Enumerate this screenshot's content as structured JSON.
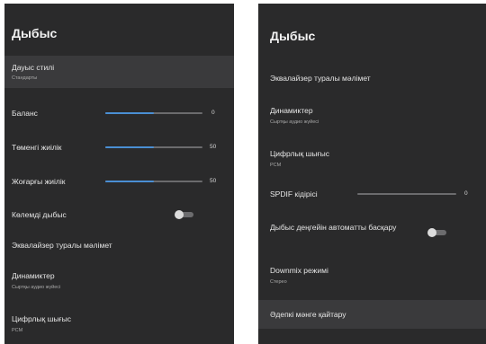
{
  "left": {
    "title": "Дыбыс",
    "items": [
      {
        "label": "Дауыс стилі",
        "sub": "Стандарты"
      },
      {
        "label": "Баланс",
        "value": "0",
        "level": 0.5
      },
      {
        "label": "Төменгі жиілік",
        "value": "50",
        "level": 0.5
      },
      {
        "label": "Жоғарғы жиілік",
        "value": "50",
        "level": 0.5
      },
      {
        "label": "Көлемді дыбыс",
        "toggle": false
      },
      {
        "label": "Эквалайзер туралы мәлімет"
      },
      {
        "label": "Динамиктер",
        "sub": "Сыртқы аудио жүйесі"
      },
      {
        "label": "Цифрлық шығыс",
        "sub": "PCM"
      }
    ]
  },
  "right": {
    "title": "Дыбыс",
    "items": [
      {
        "label": "Эквалайзер туралы мәлімет"
      },
      {
        "label": "Динамиктер",
        "sub": "Сыртқы аудио жүйесі"
      },
      {
        "label": "Цифрлық шығыс",
        "sub": "PCM"
      },
      {
        "label": "SPDIF кідірісі",
        "value": "0",
        "level": 0
      },
      {
        "label": "Дыбыс деңгейін автоматты басқару",
        "toggle": false
      },
      {
        "label": "Downmix режимі",
        "sub": "Стерео"
      },
      {
        "label": "Әдепкі мәнге қайтару"
      }
    ]
  },
  "colors": {
    "background": "#2a2a2b",
    "selected": "#3a3a3c",
    "accent": "#4a8fd4"
  }
}
